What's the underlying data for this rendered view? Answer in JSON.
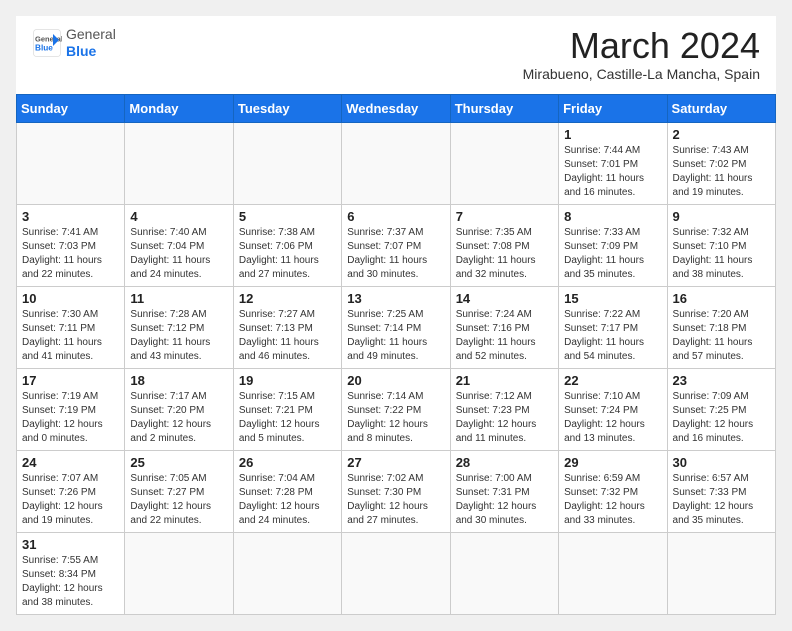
{
  "header": {
    "logo_general": "General",
    "logo_blue": "Blue",
    "month_title": "March 2024",
    "location": "Mirabueno, Castille-La Mancha, Spain"
  },
  "weekdays": [
    "Sunday",
    "Monday",
    "Tuesday",
    "Wednesday",
    "Thursday",
    "Friday",
    "Saturday"
  ],
  "weeks": [
    [
      {
        "day": "",
        "info": ""
      },
      {
        "day": "",
        "info": ""
      },
      {
        "day": "",
        "info": ""
      },
      {
        "day": "",
        "info": ""
      },
      {
        "day": "",
        "info": ""
      },
      {
        "day": "1",
        "info": "Sunrise: 7:44 AM\nSunset: 7:01 PM\nDaylight: 11 hours and 16 minutes."
      },
      {
        "day": "2",
        "info": "Sunrise: 7:43 AM\nSunset: 7:02 PM\nDaylight: 11 hours and 19 minutes."
      }
    ],
    [
      {
        "day": "3",
        "info": "Sunrise: 7:41 AM\nSunset: 7:03 PM\nDaylight: 11 hours and 22 minutes."
      },
      {
        "day": "4",
        "info": "Sunrise: 7:40 AM\nSunset: 7:04 PM\nDaylight: 11 hours and 24 minutes."
      },
      {
        "day": "5",
        "info": "Sunrise: 7:38 AM\nSunset: 7:06 PM\nDaylight: 11 hours and 27 minutes."
      },
      {
        "day": "6",
        "info": "Sunrise: 7:37 AM\nSunset: 7:07 PM\nDaylight: 11 hours and 30 minutes."
      },
      {
        "day": "7",
        "info": "Sunrise: 7:35 AM\nSunset: 7:08 PM\nDaylight: 11 hours and 32 minutes."
      },
      {
        "day": "8",
        "info": "Sunrise: 7:33 AM\nSunset: 7:09 PM\nDaylight: 11 hours and 35 minutes."
      },
      {
        "day": "9",
        "info": "Sunrise: 7:32 AM\nSunset: 7:10 PM\nDaylight: 11 hours and 38 minutes."
      }
    ],
    [
      {
        "day": "10",
        "info": "Sunrise: 7:30 AM\nSunset: 7:11 PM\nDaylight: 11 hours and 41 minutes."
      },
      {
        "day": "11",
        "info": "Sunrise: 7:28 AM\nSunset: 7:12 PM\nDaylight: 11 hours and 43 minutes."
      },
      {
        "day": "12",
        "info": "Sunrise: 7:27 AM\nSunset: 7:13 PM\nDaylight: 11 hours and 46 minutes."
      },
      {
        "day": "13",
        "info": "Sunrise: 7:25 AM\nSunset: 7:14 PM\nDaylight: 11 hours and 49 minutes."
      },
      {
        "day": "14",
        "info": "Sunrise: 7:24 AM\nSunset: 7:16 PM\nDaylight: 11 hours and 52 minutes."
      },
      {
        "day": "15",
        "info": "Sunrise: 7:22 AM\nSunset: 7:17 PM\nDaylight: 11 hours and 54 minutes."
      },
      {
        "day": "16",
        "info": "Sunrise: 7:20 AM\nSunset: 7:18 PM\nDaylight: 11 hours and 57 minutes."
      }
    ],
    [
      {
        "day": "17",
        "info": "Sunrise: 7:19 AM\nSunset: 7:19 PM\nDaylight: 12 hours and 0 minutes."
      },
      {
        "day": "18",
        "info": "Sunrise: 7:17 AM\nSunset: 7:20 PM\nDaylight: 12 hours and 2 minutes."
      },
      {
        "day": "19",
        "info": "Sunrise: 7:15 AM\nSunset: 7:21 PM\nDaylight: 12 hours and 5 minutes."
      },
      {
        "day": "20",
        "info": "Sunrise: 7:14 AM\nSunset: 7:22 PM\nDaylight: 12 hours and 8 minutes."
      },
      {
        "day": "21",
        "info": "Sunrise: 7:12 AM\nSunset: 7:23 PM\nDaylight: 12 hours and 11 minutes."
      },
      {
        "day": "22",
        "info": "Sunrise: 7:10 AM\nSunset: 7:24 PM\nDaylight: 12 hours and 13 minutes."
      },
      {
        "day": "23",
        "info": "Sunrise: 7:09 AM\nSunset: 7:25 PM\nDaylight: 12 hours and 16 minutes."
      }
    ],
    [
      {
        "day": "24",
        "info": "Sunrise: 7:07 AM\nSunset: 7:26 PM\nDaylight: 12 hours and 19 minutes."
      },
      {
        "day": "25",
        "info": "Sunrise: 7:05 AM\nSunset: 7:27 PM\nDaylight: 12 hours and 22 minutes."
      },
      {
        "day": "26",
        "info": "Sunrise: 7:04 AM\nSunset: 7:28 PM\nDaylight: 12 hours and 24 minutes."
      },
      {
        "day": "27",
        "info": "Sunrise: 7:02 AM\nSunset: 7:30 PM\nDaylight: 12 hours and 27 minutes."
      },
      {
        "day": "28",
        "info": "Sunrise: 7:00 AM\nSunset: 7:31 PM\nDaylight: 12 hours and 30 minutes."
      },
      {
        "day": "29",
        "info": "Sunrise: 6:59 AM\nSunset: 7:32 PM\nDaylight: 12 hours and 33 minutes."
      },
      {
        "day": "30",
        "info": "Sunrise: 6:57 AM\nSunset: 7:33 PM\nDaylight: 12 hours and 35 minutes."
      }
    ],
    [
      {
        "day": "31",
        "info": "Sunrise: 7:55 AM\nSunset: 8:34 PM\nDaylight: 12 hours and 38 minutes."
      },
      {
        "day": "",
        "info": ""
      },
      {
        "day": "",
        "info": ""
      },
      {
        "day": "",
        "info": ""
      },
      {
        "day": "",
        "info": ""
      },
      {
        "day": "",
        "info": ""
      },
      {
        "day": "",
        "info": ""
      }
    ]
  ]
}
